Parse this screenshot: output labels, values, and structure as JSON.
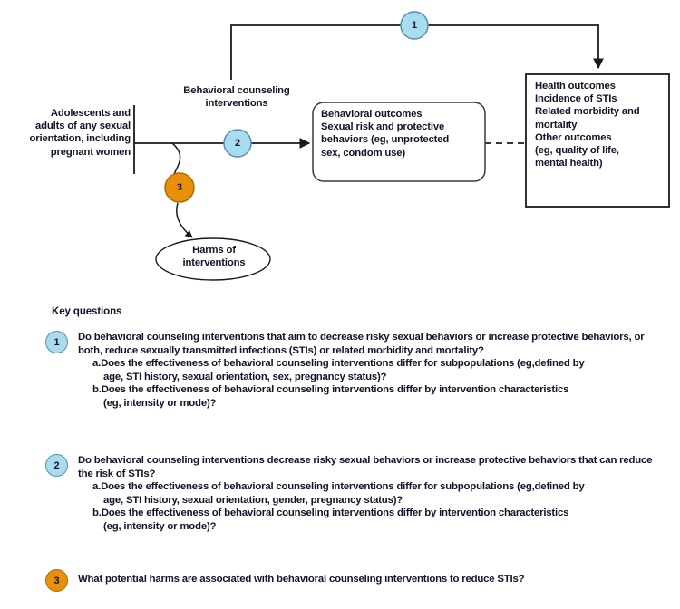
{
  "framework": {
    "population": {
      "lines": [
        "Adolescents and",
        "adults of any sexual",
        "orientation, including",
        "pregnant women"
      ]
    },
    "intervention": {
      "lines": [
        "Behavioral counseling",
        "interventions"
      ]
    },
    "behavioral_outcomes": {
      "lines": [
        "Behavioral outcomes",
        "Sexual risk and protective",
        "behaviors (eg, unprotected",
        "sex, condom use)"
      ]
    },
    "health_outcomes": {
      "lines": [
        "Health outcomes",
        "Incidence of STIs",
        "Related morbidity and",
        "mortality",
        "Other outcomes",
        "(eg, quality of life,",
        "mental health)"
      ]
    },
    "harms": {
      "lines": [
        "Harms of",
        "interventions"
      ]
    },
    "nodes": {
      "one": "1",
      "two": "2",
      "three": "3"
    },
    "colors": {
      "node_blue": "#a9dcef",
      "node_blue_border": "#5b8ea8",
      "node_orange": "#e8900c",
      "node_orange_border": "#b06a06",
      "line": "#1a1a1a",
      "text": "#13132b"
    }
  },
  "key_questions": {
    "heading": "Key questions",
    "items": [
      {
        "number": "1",
        "color": "blue",
        "main": "Do behavioral counseling interventions that aim to decrease risky sexual behaviors or increase protective behaviors, or both, reduce sexually transmitted infections (STIs) or related morbidity and mortality?",
        "sub": [
          {
            "label": "a.",
            "text": "Does the effectiveness of behavioral counseling interventions differ for subpopulations (eg,defined by",
            "cont": "age, STI history, sexual orientation, sex, pregnancy status)?"
          },
          {
            "label": "b.",
            "text": "Does the effectiveness of behavioral counseling interventions differ by intervention characteristics",
            "cont": "(eg, intensity or mode)?"
          }
        ]
      },
      {
        "number": "2",
        "color": "blue",
        "main": "Do behavioral counseling interventions decrease risky sexual behaviors or increase protective behaviors that can reduce the risk of STIs?",
        "sub": [
          {
            "label": "a.",
            "text": "Does the effectiveness of behavioral counseling interventions differ for subpopulations (eg,defined by",
            "cont": "age, STI history, sexual orientation, gender, pregnancy status)?"
          },
          {
            "label": "b.",
            "text": "Does the effectiveness of behavioral counseling interventions differ by intervention characteristics",
            "cont": "(eg, intensity or mode)?"
          }
        ]
      },
      {
        "number": "3",
        "color": "orange",
        "main": "What potential harms are associated with behavioral counseling interventions to reduce STIs?",
        "sub": []
      }
    ]
  }
}
